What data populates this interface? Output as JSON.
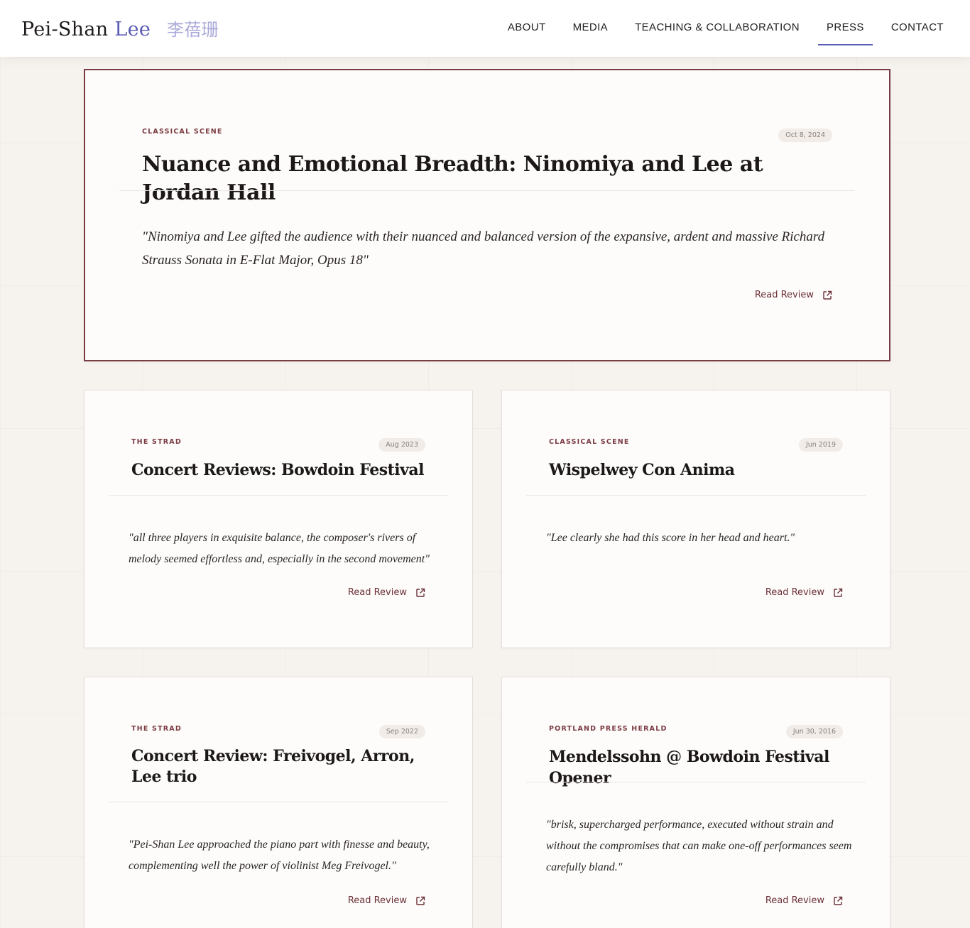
{
  "site": {
    "logo_first": "Pei-Shan",
    "logo_last": "Lee",
    "logo_cn": "李蓓珊"
  },
  "nav": {
    "items": [
      {
        "label": "ABOUT"
      },
      {
        "label": "MEDIA"
      },
      {
        "label": "TEACHING & COLLABORATION"
      },
      {
        "label": "PRESS",
        "active": true
      },
      {
        "label": "CONTACT"
      }
    ]
  },
  "colors": {
    "accent": "#5a5bb5",
    "burgundy": "#7b3b42",
    "background": "#f6f3ef"
  },
  "reviews": [
    {
      "source": "CLASSICAL SCENE",
      "date": "Oct 8, 2024",
      "title": "Nuance and Emotional Breadth: Ninomiya and Lee at Jordan Hall",
      "quote": "\"Ninomiya and Lee gifted the audience with their nuanced and balanced version of the expansive, ardent and massive Richard Strauss Sonata in E-Flat Major, Opus 18\"",
      "link_label": "Read Review",
      "link_icon": "external-link-icon",
      "featured": true
    },
    {
      "source": "THE STRAD",
      "date": "Aug 2023",
      "title": "Concert Reviews: Bowdoin Festival",
      "quote": "\"all three players in exquisite balance, the composer's rivers of melody seemed effortless and, especially in the second movement\"",
      "link_label": "Read Review",
      "link_icon": "external-link-icon"
    },
    {
      "source": "CLASSICAL SCENE",
      "date": "Jun 2019",
      "title": "Wispelwey Con Anima",
      "quote": "\"Lee clearly she had this score in her head and heart.\"",
      "link_label": "Read Review",
      "link_icon": "external-link-icon"
    },
    {
      "source": "THE STRAD",
      "date": "Sep 2022",
      "title": "Concert Review: Freivogel, Arron, Lee trio",
      "quote": "\"Pei-Shan Lee approached the piano part with finesse and beauty, complementing well the power of violinist Meg Freivogel.\"",
      "link_label": "Read Review",
      "link_icon": "external-link-icon"
    },
    {
      "source": "PORTLAND PRESS HERALD",
      "date": "Jun 30, 2016",
      "title": "Mendelssohn @ Bowdoin Festival Opener",
      "quote": "\"brisk, supercharged performance, executed without strain and without the compromises that can make one-off performances seem carefully bland.\"",
      "link_label": "Read Review",
      "link_icon": "external-link-icon"
    }
  ]
}
